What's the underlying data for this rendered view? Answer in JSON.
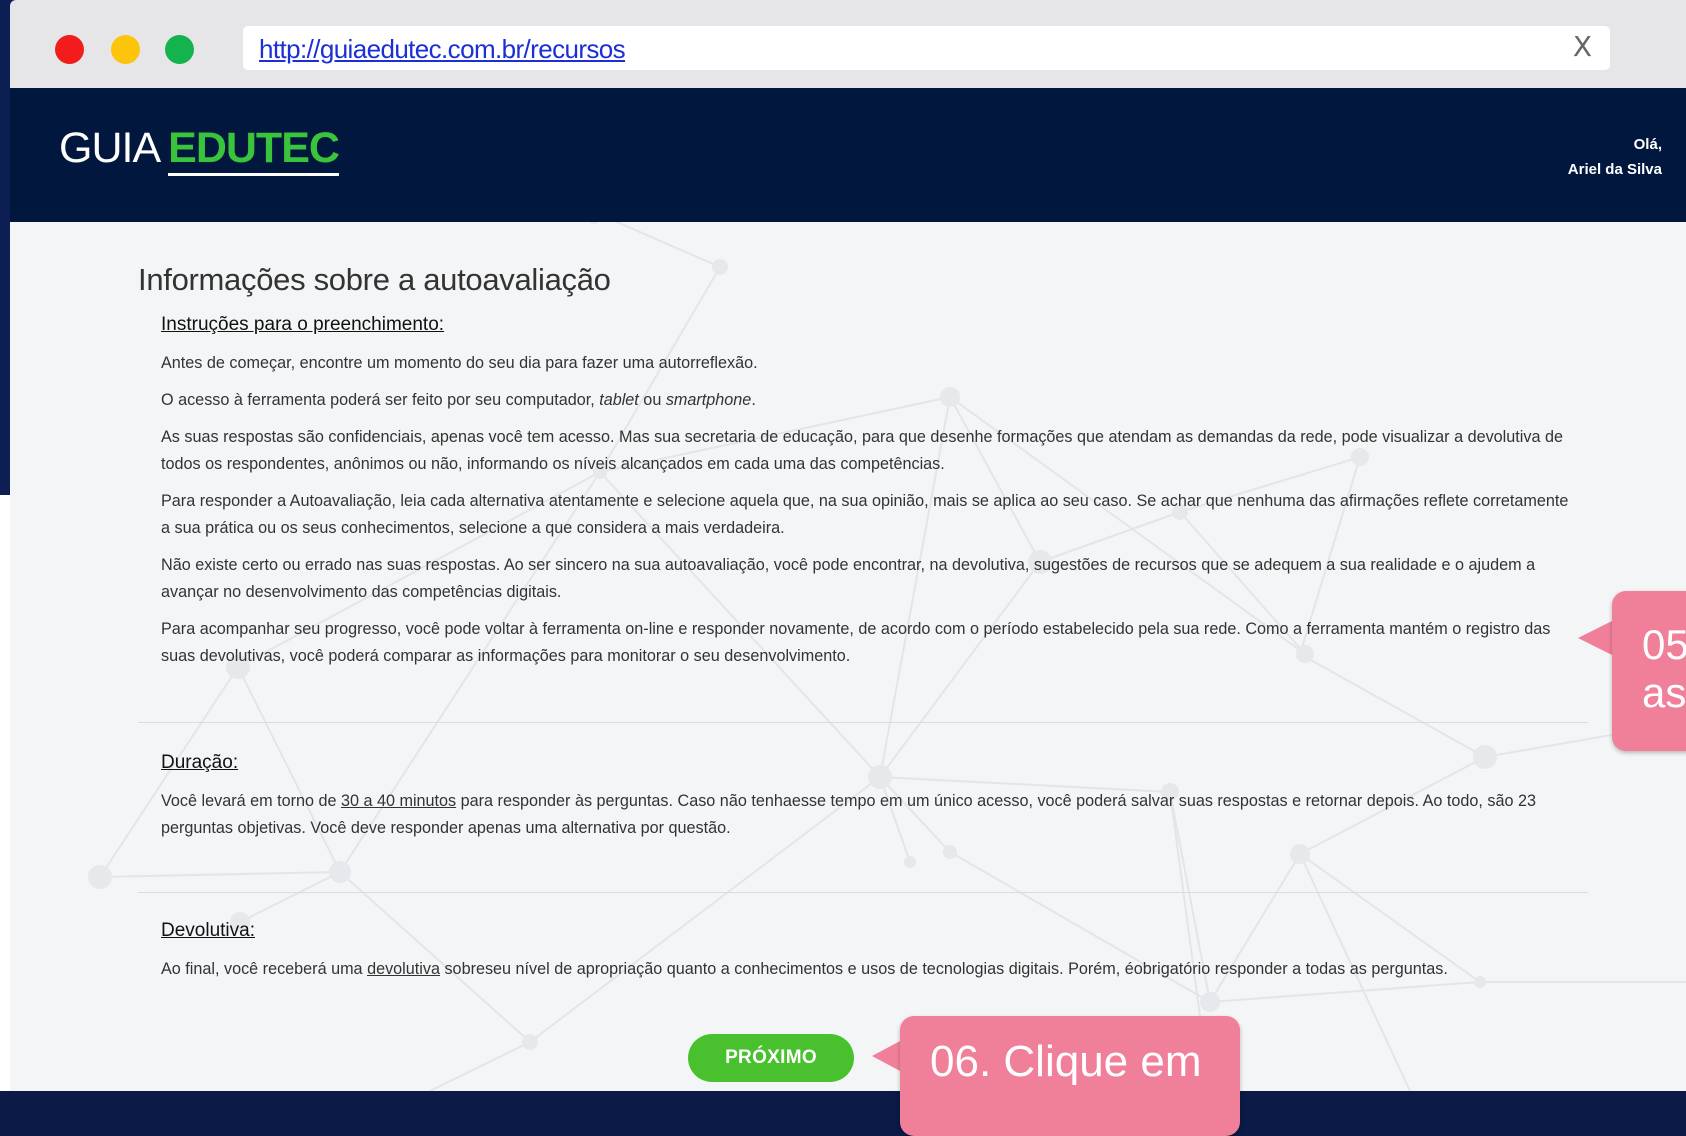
{
  "browser": {
    "url": "http://guiaedutec.com.br/recursos",
    "close_label": "X"
  },
  "header": {
    "logo_light": "GUIA",
    "logo_strong": "EDUTEC",
    "greeting": "Olá,",
    "user_name": "Ariel da Silva"
  },
  "page": {
    "title": "Informações sobre a autoavaliação"
  },
  "instructions": {
    "heading": "Instruções para o preenchimento:",
    "p1": "Antes de começar, encontre um momento do seu dia para fazer uma autorreflexão.",
    "p2_a": "O acesso à ferramenta poderá ser feito por seu computador, ",
    "p2_b": "tablet",
    "p2_c": " ou ",
    "p2_d": "smartphone",
    "p2_e": ".",
    "p3": "As suas respostas são confidenciais, apenas você tem acesso. Mas sua secretaria de educação, para que desenhe formações que atendam as demandas da rede, pode visualizar a devolutiva de todos os respondentes, anônimos ou não, informando os níveis alcançados em cada uma das competências.",
    "p4": "Para responder a Autoavaliação, leia cada alternativa atentamente e selecione aquela que, na sua opinião, mais se aplica ao seu caso. Se achar que nenhuma das afirmações reflete corretamente a sua prática ou os seus conhecimentos, selecione a que considera a mais verdadeira.",
    "p5": "Não existe certo ou errado nas suas respostas. Ao ser sincero na sua autoavaliação, você pode encontrar, na devolutiva, sugestões de recursos que se adequem a sua realidade e o ajudem a avançar no desenvolvimento das competências digitais.",
    "p6": "Para acompanhar seu progresso, você pode voltar à ferramenta on-line e responder novamente, de acordo com o período estabelecido pela sua rede. Como a ferramenta mantém o registro das suas devolutivas, você poderá comparar as informações para monitorar o seu desenvolvimento."
  },
  "duration": {
    "heading": "Duração:",
    "text_a": "Você levará em torno de ",
    "text_link": "30 a 40 minutos",
    "text_b": " para responder às perguntas. Caso não tenhaesse tempo em um único acesso, você poderá salvar suas respostas e retornar depois. Ao todo, são 23 perguntas objetivas. Você deve responder apenas uma alternativa por questão."
  },
  "feedback": {
    "heading": "Devolutiva:",
    "text_a": "Ao final, você receberá uma ",
    "text_link": "devolutiva",
    "text_b": " sobreseu nível de apropriação quanto a conhecimentos e usos de tecnologias digitais. Porém, éobrigatório responder a todas as perguntas."
  },
  "actions": {
    "next_label": "PRÓXIMO"
  },
  "callouts": {
    "step5_line1": "05",
    "step5_line2": "as",
    "step6": "06. Clique em"
  },
  "colors": {
    "header_bg": "#02173d",
    "accent_green": "#49c12f",
    "logo_green": "#39c43c",
    "callout_pink": "#f07f9a"
  }
}
